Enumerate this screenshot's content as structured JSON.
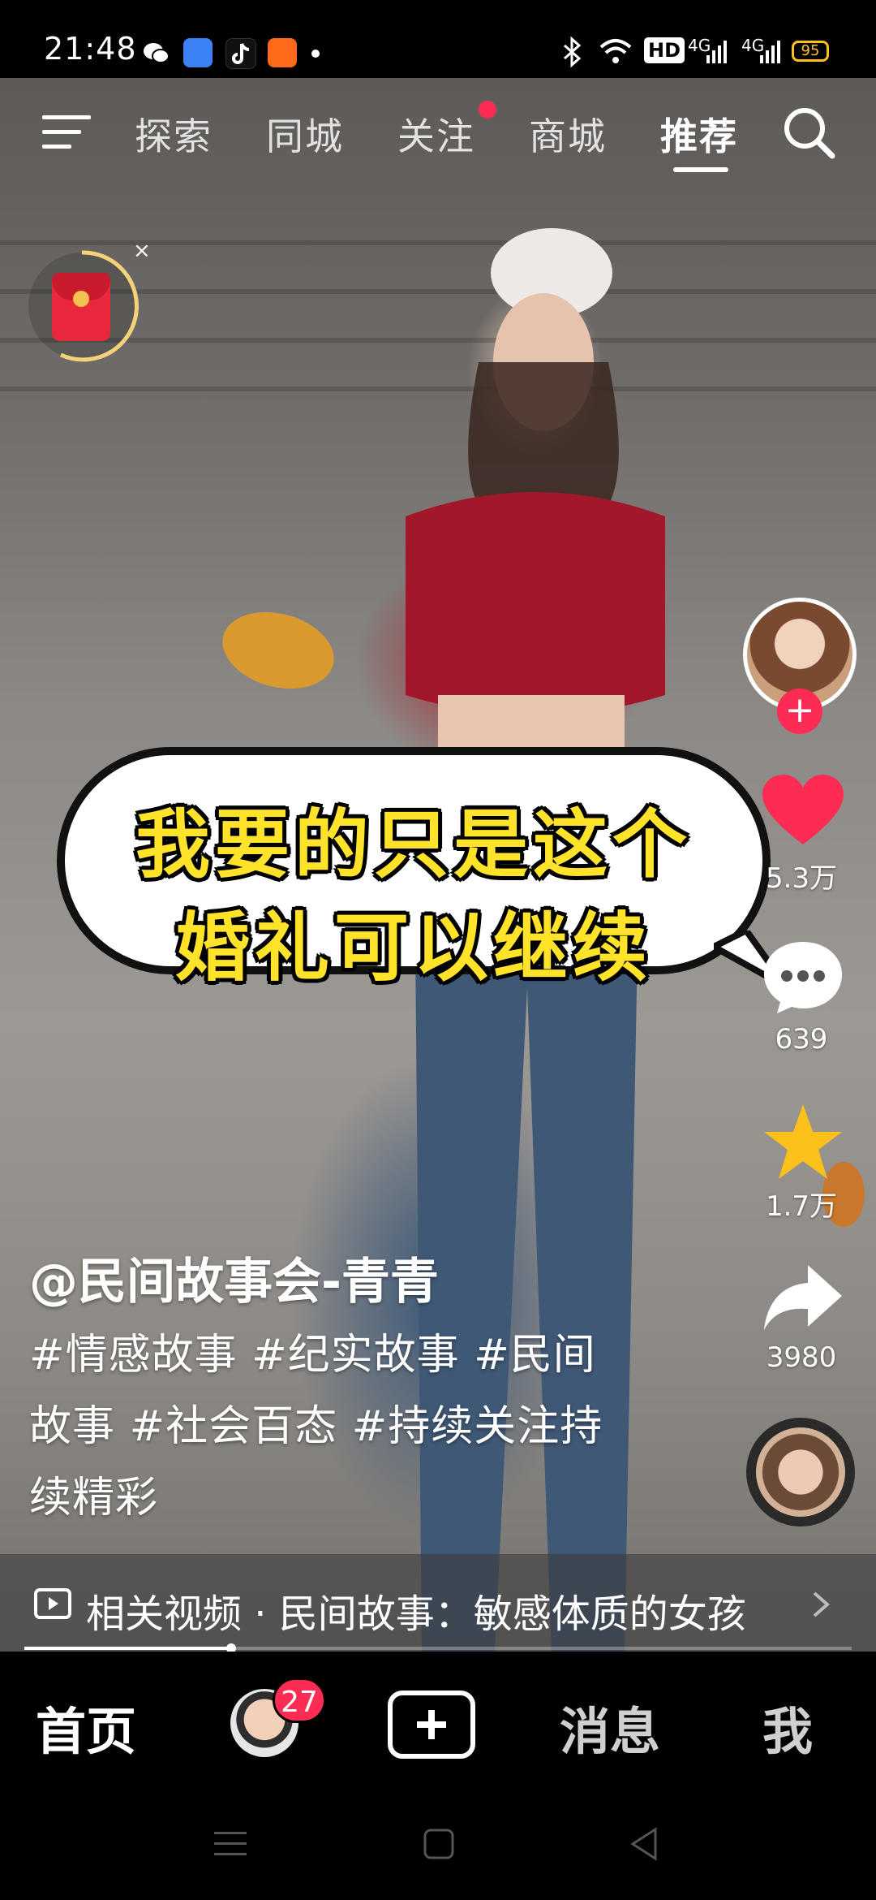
{
  "status_bar": {
    "time": "21:48",
    "signal_1": "4G",
    "signal_2": "4G",
    "hd_badge": "HD",
    "battery": "95"
  },
  "top_tabs": [
    {
      "label": "探索"
    },
    {
      "label": "同城"
    },
    {
      "label": "关注"
    },
    {
      "label": "商城"
    },
    {
      "label": "推荐"
    }
  ],
  "red_packet": {
    "close": "×"
  },
  "video": {
    "subtitle_line1": "我要的只是这个",
    "subtitle_line2": "婚礼可以继续"
  },
  "actions": {
    "likes": "5.3万",
    "comments": "639",
    "favorites": "1.7万",
    "shares": "3980"
  },
  "caption": {
    "author": "@民间故事会-青青",
    "line1": "#情感故事 #纪实故事 #民间",
    "line2": "故事 #社会百态 #持续关注持",
    "line3": "续精彩"
  },
  "related": {
    "text": "相关视频 · 民间故事：敏感体质的女孩"
  },
  "bottom_nav": {
    "home": "首页",
    "friends_badge": "27",
    "messages": "消息",
    "me": "我"
  },
  "progress": {
    "value": 0.25
  },
  "colors": {
    "accent": "#fe2c55",
    "subtitle": "#ffe22a",
    "star": "#fcc21b"
  }
}
